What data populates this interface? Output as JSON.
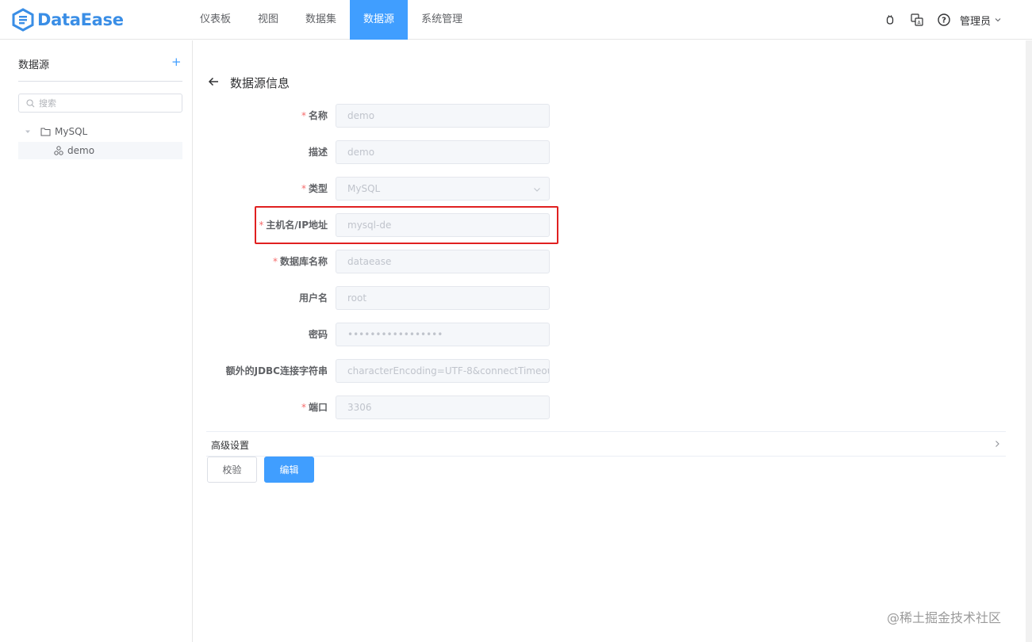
{
  "app": {
    "logo_text": "DataEase",
    "brand_color": "#409eff"
  },
  "nav": {
    "items": [
      {
        "label": "仪表板",
        "active": false
      },
      {
        "label": "视图",
        "active": false
      },
      {
        "label": "数据集",
        "active": false
      },
      {
        "label": "数据源",
        "active": true
      },
      {
        "label": "系统管理",
        "active": false
      }
    ]
  },
  "topbar": {
    "icons": [
      "bug-icon",
      "translate-icon",
      "help-icon"
    ],
    "user_name": "管理员"
  },
  "sidebar": {
    "title": "数据源",
    "add_label": "+",
    "search_placeholder": "搜索",
    "tree": {
      "root_label": "MySQL",
      "child_label": "demo"
    }
  },
  "main": {
    "title": "数据源信息",
    "fields": [
      {
        "label": "名称",
        "required": true,
        "value": "demo"
      },
      {
        "label": "描述",
        "required": false,
        "value": "demo"
      },
      {
        "label": "类型",
        "required": true,
        "value": "MySQL",
        "select": true
      },
      {
        "label": "主机名/IP地址",
        "required": true,
        "value": "mysql-de"
      },
      {
        "label": "数据库名称",
        "required": true,
        "value": "dataease"
      },
      {
        "label": "用户名",
        "required": false,
        "value": "root"
      },
      {
        "label": "密码",
        "required": false,
        "value": "•••••••••••••••••"
      },
      {
        "label": "额外的JDBC连接字符串",
        "required": false,
        "value": "characterEncoding=UTF-8&connectTimeou"
      },
      {
        "label": "端口",
        "required": true,
        "value": "3306"
      }
    ],
    "required_mark": "*",
    "advanced_label": "高级设置",
    "validate_button": "校验",
    "edit_button": "编辑"
  },
  "watermark": "@稀土掘金技术社区"
}
